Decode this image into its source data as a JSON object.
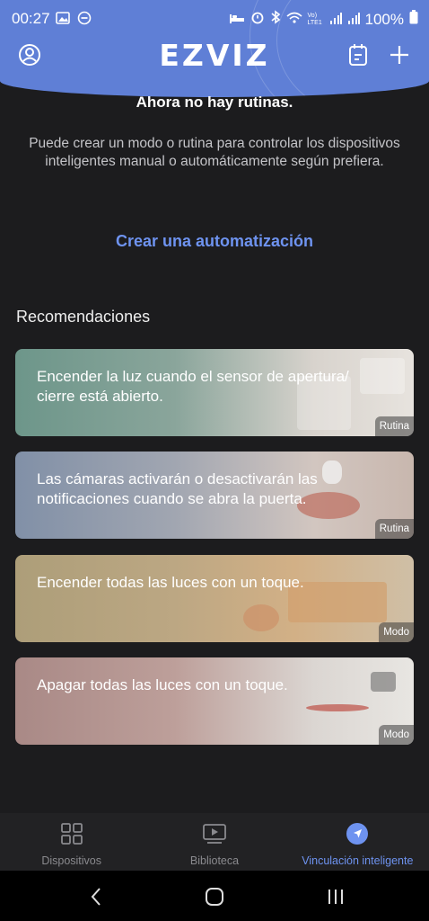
{
  "status_bar": {
    "time": "00:27",
    "battery": "100%",
    "network_label": "Vo) LTE1"
  },
  "header": {
    "logo": "EZVIZ",
    "accent_color": "#5f7fd6"
  },
  "empty_state": {
    "title": "Ahora no hay rutinas.",
    "description": "Puede crear un modo o rutina para controlar los dispositivos inteligentes manual o automáticamente según prefiera.",
    "create_link": "Crear una automatización"
  },
  "recommendations": {
    "title": "Recomendaciones",
    "items": [
      {
        "text": "Encender la luz cuando el sensor de apertura/ cierre está abierto.",
        "badge": "Rutina"
      },
      {
        "text": "Las cámaras activarán o desactivarán las notificaciones cuando se abra la puerta.",
        "badge": "Rutina"
      },
      {
        "text": "Encender todas las luces con un toque.",
        "badge": "Modo"
      },
      {
        "text": "Apagar todas las luces con un toque.",
        "badge": "Modo"
      }
    ]
  },
  "tabbar": {
    "tabs": [
      {
        "label": "Dispositivos",
        "icon": "grid-icon"
      },
      {
        "label": "Biblioteca",
        "icon": "play-library-icon"
      },
      {
        "label": "Vinculación inteligente",
        "icon": "navigation-arrow-icon"
      }
    ],
    "active_index": 2
  }
}
